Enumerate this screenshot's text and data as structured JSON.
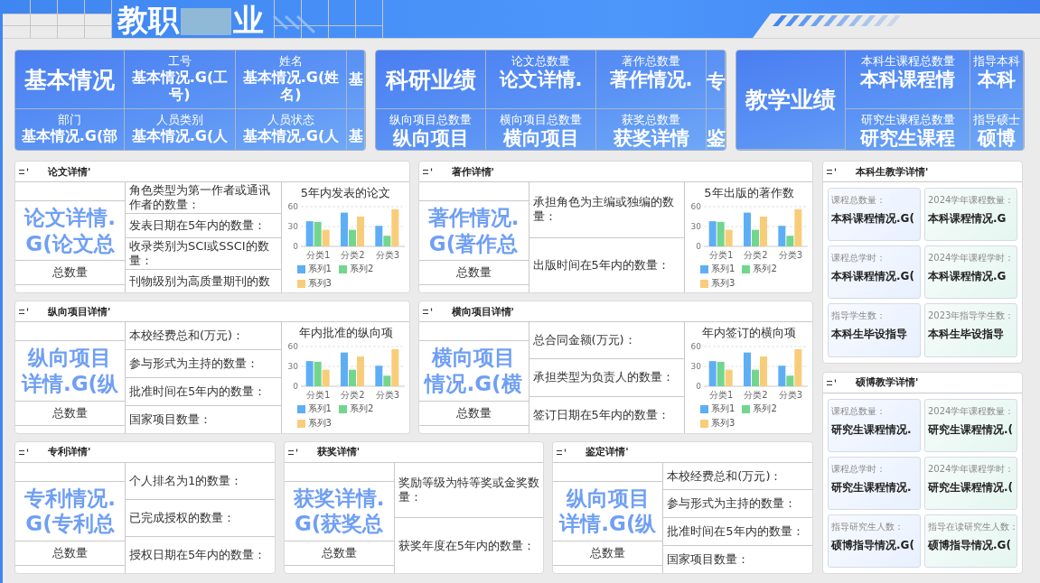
{
  "header": {
    "title_parts": [
      "教职",
      "业"
    ]
  },
  "summary_panels": [
    {
      "heading": "基本情况",
      "rows": [
        [
          "",
          {
            "label": "工号",
            "value": "基本情况.G(工号)"
          },
          {
            "label": "姓名",
            "value": "基本情况.G(姓名)"
          },
          {
            "value": "基"
          }
        ],
        [
          {
            "label": "部门",
            "value": "基本情况.G(部"
          },
          {
            "label": "人员类别",
            "value": "基本情况.G(人"
          },
          {
            "label": "人员状态",
            "value": "基本情况.G(人"
          },
          {
            "value": "基"
          }
        ]
      ]
    },
    {
      "heading": "科研业绩",
      "rows": [
        [
          "",
          {
            "label": "论文总数量",
            "value": "论文详情."
          },
          {
            "label": "著作总数量",
            "value": "著作情况."
          },
          {
            "value": "专"
          }
        ],
        [
          {
            "label": "纵向项目总数量",
            "value": "纵向项目"
          },
          {
            "label": "横向项目总数量",
            "value": "横向项目"
          },
          {
            "label": "获奖总数量",
            "value": "获奖详情"
          },
          {
            "value": "鉴"
          }
        ]
      ]
    },
    {
      "heading": "教学业绩",
      "rows": [
        [
          "",
          {
            "label": "本科生课程总数量",
            "value": "本科课程情"
          },
          {
            "label": "指导本科",
            "value": "本科"
          }
        ],
        [
          "",
          {
            "label": "研究生课程总数量",
            "value": "研究生课程"
          },
          {
            "label": "指导硕士",
            "value": "硕博"
          }
        ]
      ]
    }
  ],
  "detail_rows": [
    [
      {
        "title": "论文详情'",
        "main_value_lines": [
          "论文详情.",
          "G(论文总"
        ],
        "caption": "总数量",
        "items": [
          "角色类型为第一作者或通讯作者的数量：",
          "发表日期在5年内的数量：",
          "收录类别为SCI或SSCI的数量：",
          "刊物级别为高质量期刊的数"
        ],
        "chart_data": {
          "type": "bar",
          "title": "5年内发表的论文",
          "categories": [
            "分类1",
            "分类2",
            "分类3"
          ],
          "series": [
            {
              "name": "系列1",
              "color": "#5eaef5",
              "values": [
                38,
                51,
                31
              ]
            },
            {
              "name": "系列2",
              "color": "#72d68e",
              "values": [
                37,
                25,
                16
              ]
            },
            {
              "name": "系列3",
              "color": "#f8cd7a",
              "values": [
                25,
                45,
                56
              ]
            }
          ],
          "ylim": [
            0,
            60
          ],
          "yticks": [
            0,
            30,
            60
          ],
          "legend": "bottom"
        }
      },
      {
        "title": "著作详情'",
        "main_value_lines": [
          "著作情况.",
          "G(著作总"
        ],
        "caption": "总数量",
        "items": [
          "承担角色为主编或独编的数量：",
          "出版时间在5年内的数量："
        ],
        "chart_data": {
          "type": "bar",
          "title": "5年出版的著作数",
          "categories": [
            "分类1",
            "分类2",
            "分类3"
          ],
          "series": [
            {
              "name": "系列1",
              "color": "#5eaef5",
              "values": [
                38,
                51,
                31
              ]
            },
            {
              "name": "系列2",
              "color": "#72d68e",
              "values": [
                37,
                25,
                16
              ]
            },
            {
              "name": "系列3",
              "color": "#f8cd7a",
              "values": [
                25,
                45,
                56
              ]
            }
          ],
          "ylim": [
            0,
            60
          ],
          "yticks": [
            0,
            30,
            60
          ],
          "legend": "bottom"
        }
      }
    ],
    [
      {
        "title": "纵向项目详情'",
        "main_value_lines": [
          "纵向项目",
          "详情.G(纵"
        ],
        "caption": "总数量",
        "items": [
          "本校经费总和(万元)：",
          "参与形式为主持的数量：",
          "批准时间在5年内的数量：",
          "国家项目数量："
        ],
        "chart_data": {
          "type": "bar",
          "title": "年内批准的纵向项",
          "categories": [
            "分类1",
            "分类2",
            "分类3"
          ],
          "series": [
            {
              "name": "系列1",
              "color": "#5eaef5",
              "values": [
                38,
                51,
                31
              ]
            },
            {
              "name": "系列2",
              "color": "#72d68e",
              "values": [
                37,
                25,
                16
              ]
            },
            {
              "name": "系列3",
              "color": "#f8cd7a",
              "values": [
                25,
                45,
                56
              ]
            }
          ],
          "ylim": [
            0,
            60
          ],
          "yticks": [
            0,
            30,
            60
          ],
          "legend": "bottom"
        }
      },
      {
        "title": "横向项目详情'",
        "main_value_lines": [
          "横向项目",
          "情况.G(横"
        ],
        "caption": "总数量",
        "items": [
          "总合同金额(万元)：",
          "承担类型为负责人的数量：",
          "签订日期在5年内的数量："
        ],
        "chart_data": {
          "type": "bar",
          "title": "年内签订的横向项",
          "categories": [
            "分类1",
            "分类2",
            "分类3"
          ],
          "series": [
            {
              "name": "系列1",
              "color": "#5eaef5",
              "values": [
                38,
                51,
                31
              ]
            },
            {
              "name": "系列2",
              "color": "#72d68e",
              "values": [
                37,
                25,
                16
              ]
            },
            {
              "name": "系列3",
              "color": "#f8cd7a",
              "values": [
                25,
                45,
                56
              ]
            }
          ],
          "ylim": [
            0,
            60
          ],
          "yticks": [
            0,
            30,
            60
          ],
          "legend": "bottom"
        }
      }
    ],
    [
      {
        "title": "专利详情'",
        "main_value_lines": [
          "专利情况.",
          "G(专利总"
        ],
        "caption": "总数量",
        "items": [
          "个人排名为1的数量：",
          "已完成授权的数量：",
          "授权日期在5年内的数量："
        ]
      },
      {
        "title": "获奖详情'",
        "main_value_lines": [
          "获奖详情.",
          "G(获奖总"
        ],
        "caption": "总数量",
        "items": [
          "奖励等级为特等奖或金奖数量：",
          "获奖年度在5年内的数量："
        ]
      },
      {
        "title": "鉴定详情'",
        "main_value_lines": [
          "纵向项目",
          "详情.G(纵"
        ],
        "caption": "总数量",
        "items": [
          "本校经费总和(万元)：",
          "参与形式为主持的数量：",
          "批准时间在5年内的数量：",
          "国家项目数量："
        ]
      }
    ]
  ],
  "teaching_cards": [
    {
      "title": "本科生教学详情'",
      "tiles": [
        {
          "label": "课程总数量：",
          "value": "本科课程情况.G("
        },
        {
          "label": "2024学年课程数量：",
          "value": "本科课程情况.G"
        },
        {
          "label": "课程总学时：",
          "value": "本科课程情况.G("
        },
        {
          "label": "2024学年课程学时：",
          "value": "本科课程情况.G"
        },
        {
          "label": "指导学生数：",
          "value": "本科生毕设指导"
        },
        {
          "label": "2023年指导学生数：",
          "value": "本科生毕设指导"
        }
      ]
    },
    {
      "title": "硕博教学详情'",
      "tiles": [
        {
          "label": "课程总数量：",
          "value": "研究生课程情况."
        },
        {
          "label": "2024学年课程数量：",
          "value": "研究生课程情况.("
        },
        {
          "label": "课程总学时：",
          "value": "研究生课程情况."
        },
        {
          "label": "2024学年课程学时：",
          "value": "研究生课程情况.("
        },
        {
          "label": "指导研究生人数：",
          "value": "硕博指导情况.G("
        },
        {
          "label": "指导在读研究生人数：",
          "value": "硕博指导情况.G("
        }
      ]
    }
  ]
}
